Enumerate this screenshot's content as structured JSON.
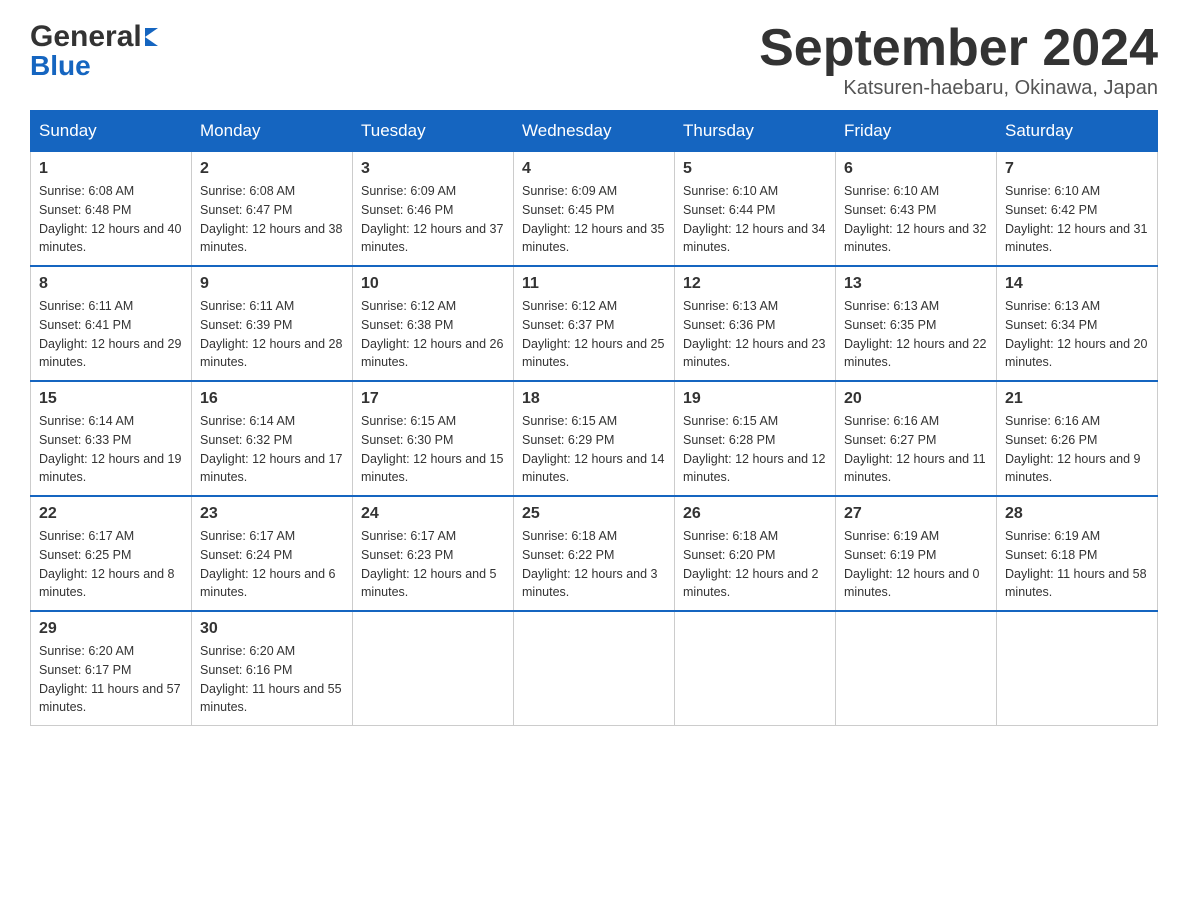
{
  "header": {
    "logo_line1": "General",
    "logo_line2": "Blue",
    "month_title": "September 2024",
    "location": "Katsuren-haebaru, Okinawa, Japan"
  },
  "days_of_week": [
    "Sunday",
    "Monday",
    "Tuesday",
    "Wednesday",
    "Thursday",
    "Friday",
    "Saturday"
  ],
  "weeks": [
    [
      {
        "day": "1",
        "sunrise": "6:08 AM",
        "sunset": "6:48 PM",
        "daylight": "12 hours and 40 minutes."
      },
      {
        "day": "2",
        "sunrise": "6:08 AM",
        "sunset": "6:47 PM",
        "daylight": "12 hours and 38 minutes."
      },
      {
        "day": "3",
        "sunrise": "6:09 AM",
        "sunset": "6:46 PM",
        "daylight": "12 hours and 37 minutes."
      },
      {
        "day": "4",
        "sunrise": "6:09 AM",
        "sunset": "6:45 PM",
        "daylight": "12 hours and 35 minutes."
      },
      {
        "day": "5",
        "sunrise": "6:10 AM",
        "sunset": "6:44 PM",
        "daylight": "12 hours and 34 minutes."
      },
      {
        "day": "6",
        "sunrise": "6:10 AM",
        "sunset": "6:43 PM",
        "daylight": "12 hours and 32 minutes."
      },
      {
        "day": "7",
        "sunrise": "6:10 AM",
        "sunset": "6:42 PM",
        "daylight": "12 hours and 31 minutes."
      }
    ],
    [
      {
        "day": "8",
        "sunrise": "6:11 AM",
        "sunset": "6:41 PM",
        "daylight": "12 hours and 29 minutes."
      },
      {
        "day": "9",
        "sunrise": "6:11 AM",
        "sunset": "6:39 PM",
        "daylight": "12 hours and 28 minutes."
      },
      {
        "day": "10",
        "sunrise": "6:12 AM",
        "sunset": "6:38 PM",
        "daylight": "12 hours and 26 minutes."
      },
      {
        "day": "11",
        "sunrise": "6:12 AM",
        "sunset": "6:37 PM",
        "daylight": "12 hours and 25 minutes."
      },
      {
        "day": "12",
        "sunrise": "6:13 AM",
        "sunset": "6:36 PM",
        "daylight": "12 hours and 23 minutes."
      },
      {
        "day": "13",
        "sunrise": "6:13 AM",
        "sunset": "6:35 PM",
        "daylight": "12 hours and 22 minutes."
      },
      {
        "day": "14",
        "sunrise": "6:13 AM",
        "sunset": "6:34 PM",
        "daylight": "12 hours and 20 minutes."
      }
    ],
    [
      {
        "day": "15",
        "sunrise": "6:14 AM",
        "sunset": "6:33 PM",
        "daylight": "12 hours and 19 minutes."
      },
      {
        "day": "16",
        "sunrise": "6:14 AM",
        "sunset": "6:32 PM",
        "daylight": "12 hours and 17 minutes."
      },
      {
        "day": "17",
        "sunrise": "6:15 AM",
        "sunset": "6:30 PM",
        "daylight": "12 hours and 15 minutes."
      },
      {
        "day": "18",
        "sunrise": "6:15 AM",
        "sunset": "6:29 PM",
        "daylight": "12 hours and 14 minutes."
      },
      {
        "day": "19",
        "sunrise": "6:15 AM",
        "sunset": "6:28 PM",
        "daylight": "12 hours and 12 minutes."
      },
      {
        "day": "20",
        "sunrise": "6:16 AM",
        "sunset": "6:27 PM",
        "daylight": "12 hours and 11 minutes."
      },
      {
        "day": "21",
        "sunrise": "6:16 AM",
        "sunset": "6:26 PM",
        "daylight": "12 hours and 9 minutes."
      }
    ],
    [
      {
        "day": "22",
        "sunrise": "6:17 AM",
        "sunset": "6:25 PM",
        "daylight": "12 hours and 8 minutes."
      },
      {
        "day": "23",
        "sunrise": "6:17 AM",
        "sunset": "6:24 PM",
        "daylight": "12 hours and 6 minutes."
      },
      {
        "day": "24",
        "sunrise": "6:17 AM",
        "sunset": "6:23 PM",
        "daylight": "12 hours and 5 minutes."
      },
      {
        "day": "25",
        "sunrise": "6:18 AM",
        "sunset": "6:22 PM",
        "daylight": "12 hours and 3 minutes."
      },
      {
        "day": "26",
        "sunrise": "6:18 AM",
        "sunset": "6:20 PM",
        "daylight": "12 hours and 2 minutes."
      },
      {
        "day": "27",
        "sunrise": "6:19 AM",
        "sunset": "6:19 PM",
        "daylight": "12 hours and 0 minutes."
      },
      {
        "day": "28",
        "sunrise": "6:19 AM",
        "sunset": "6:18 PM",
        "daylight": "11 hours and 58 minutes."
      }
    ],
    [
      {
        "day": "29",
        "sunrise": "6:20 AM",
        "sunset": "6:17 PM",
        "daylight": "11 hours and 57 minutes."
      },
      {
        "day": "30",
        "sunrise": "6:20 AM",
        "sunset": "6:16 PM",
        "daylight": "11 hours and 55 minutes."
      },
      null,
      null,
      null,
      null,
      null
    ]
  ]
}
